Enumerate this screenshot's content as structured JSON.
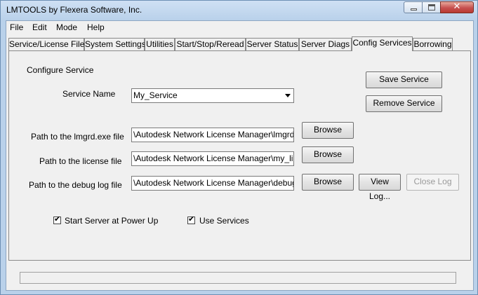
{
  "window": {
    "title": "LMTOOLS by Flexera Software, Inc."
  },
  "menu": {
    "items": [
      "File",
      "Edit",
      "Mode",
      "Help"
    ]
  },
  "tabs": [
    {
      "label": "Service/License File"
    },
    {
      "label": "System Settings"
    },
    {
      "label": "Utilities"
    },
    {
      "label": "Start/Stop/Reread"
    },
    {
      "label": "Server Status"
    },
    {
      "label": "Server Diags"
    },
    {
      "label": "Config Services",
      "active": true
    },
    {
      "label": "Borrowing"
    }
  ],
  "config": {
    "heading": "Configure Service",
    "service_name_label": "Service Name",
    "service_name_value": "My_Service",
    "save_button": "Save Service",
    "remove_button": "Remove Service",
    "lmgrd_label": "Path to the lmgrd.exe file",
    "lmgrd_value": "\\Autodesk Network License Manager\\lmgrd.exe",
    "license_label": "Path to the license file",
    "license_value": "\\Autodesk Network License Manager\\my_lic.lic",
    "debug_label": "Path to the debug log file",
    "debug_value": "\\Autodesk Network License Manager\\debug.log",
    "browse_label": "Browse",
    "view_log_button": "View Log...",
    "close_log_button": "Close Log",
    "start_server_label": "Start Server at Power Up",
    "start_server_checked": true,
    "use_services_label": "Use Services",
    "use_services_checked": true
  },
  "status": {
    "text": ""
  }
}
